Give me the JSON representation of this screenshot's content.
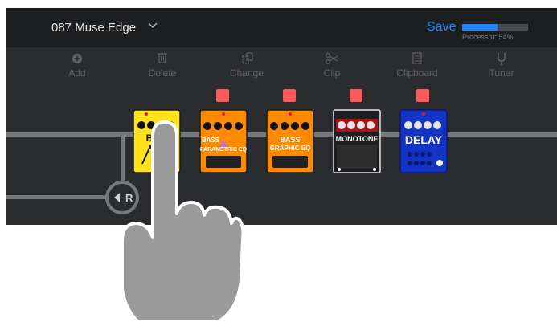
{
  "header": {
    "patch_name": "087 Muse Edge",
    "save_label": "Save",
    "processor_text": "Processor: 54%",
    "processor_load": 0.54
  },
  "toolbar": [
    {
      "label": "Add",
      "icon": "add-icon"
    },
    {
      "label": "Delete",
      "icon": "trash-icon"
    },
    {
      "label": "Change",
      "icon": "change-icon"
    },
    {
      "label": "Clip",
      "icon": "scissors-icon"
    },
    {
      "label": "Clipboard",
      "icon": "clipboard-icon"
    },
    {
      "label": "Tuner",
      "icon": "tuner-icon"
    }
  ],
  "signal_chain": {
    "return_label": "R"
  },
  "pedals": [
    {
      "name": "BPM",
      "color": "#ffe21a",
      "line1": "BPM",
      "line2": ""
    },
    {
      "name": "BASS PARAMETRIC EQ",
      "color": "#ff8a00",
      "line1": "BASS",
      "line2": "PARAMETRIC EQ"
    },
    {
      "name": "BASS GRAPHIC EQ",
      "color": "#ff8a00",
      "line1": "BASS",
      "line2": "GRAPHIC EQ"
    },
    {
      "name": "MONOTONE",
      "color": "#1e1e1e",
      "line1": "MONOTONE",
      "line2": ""
    },
    {
      "name": "DELAY",
      "color": "#1233c4",
      "line1": "DELAY",
      "line2": ""
    }
  ],
  "colors": {
    "accent": "#1a8cff",
    "onoff_red": "#ff5a5a",
    "panel": "#2b2c2f"
  }
}
